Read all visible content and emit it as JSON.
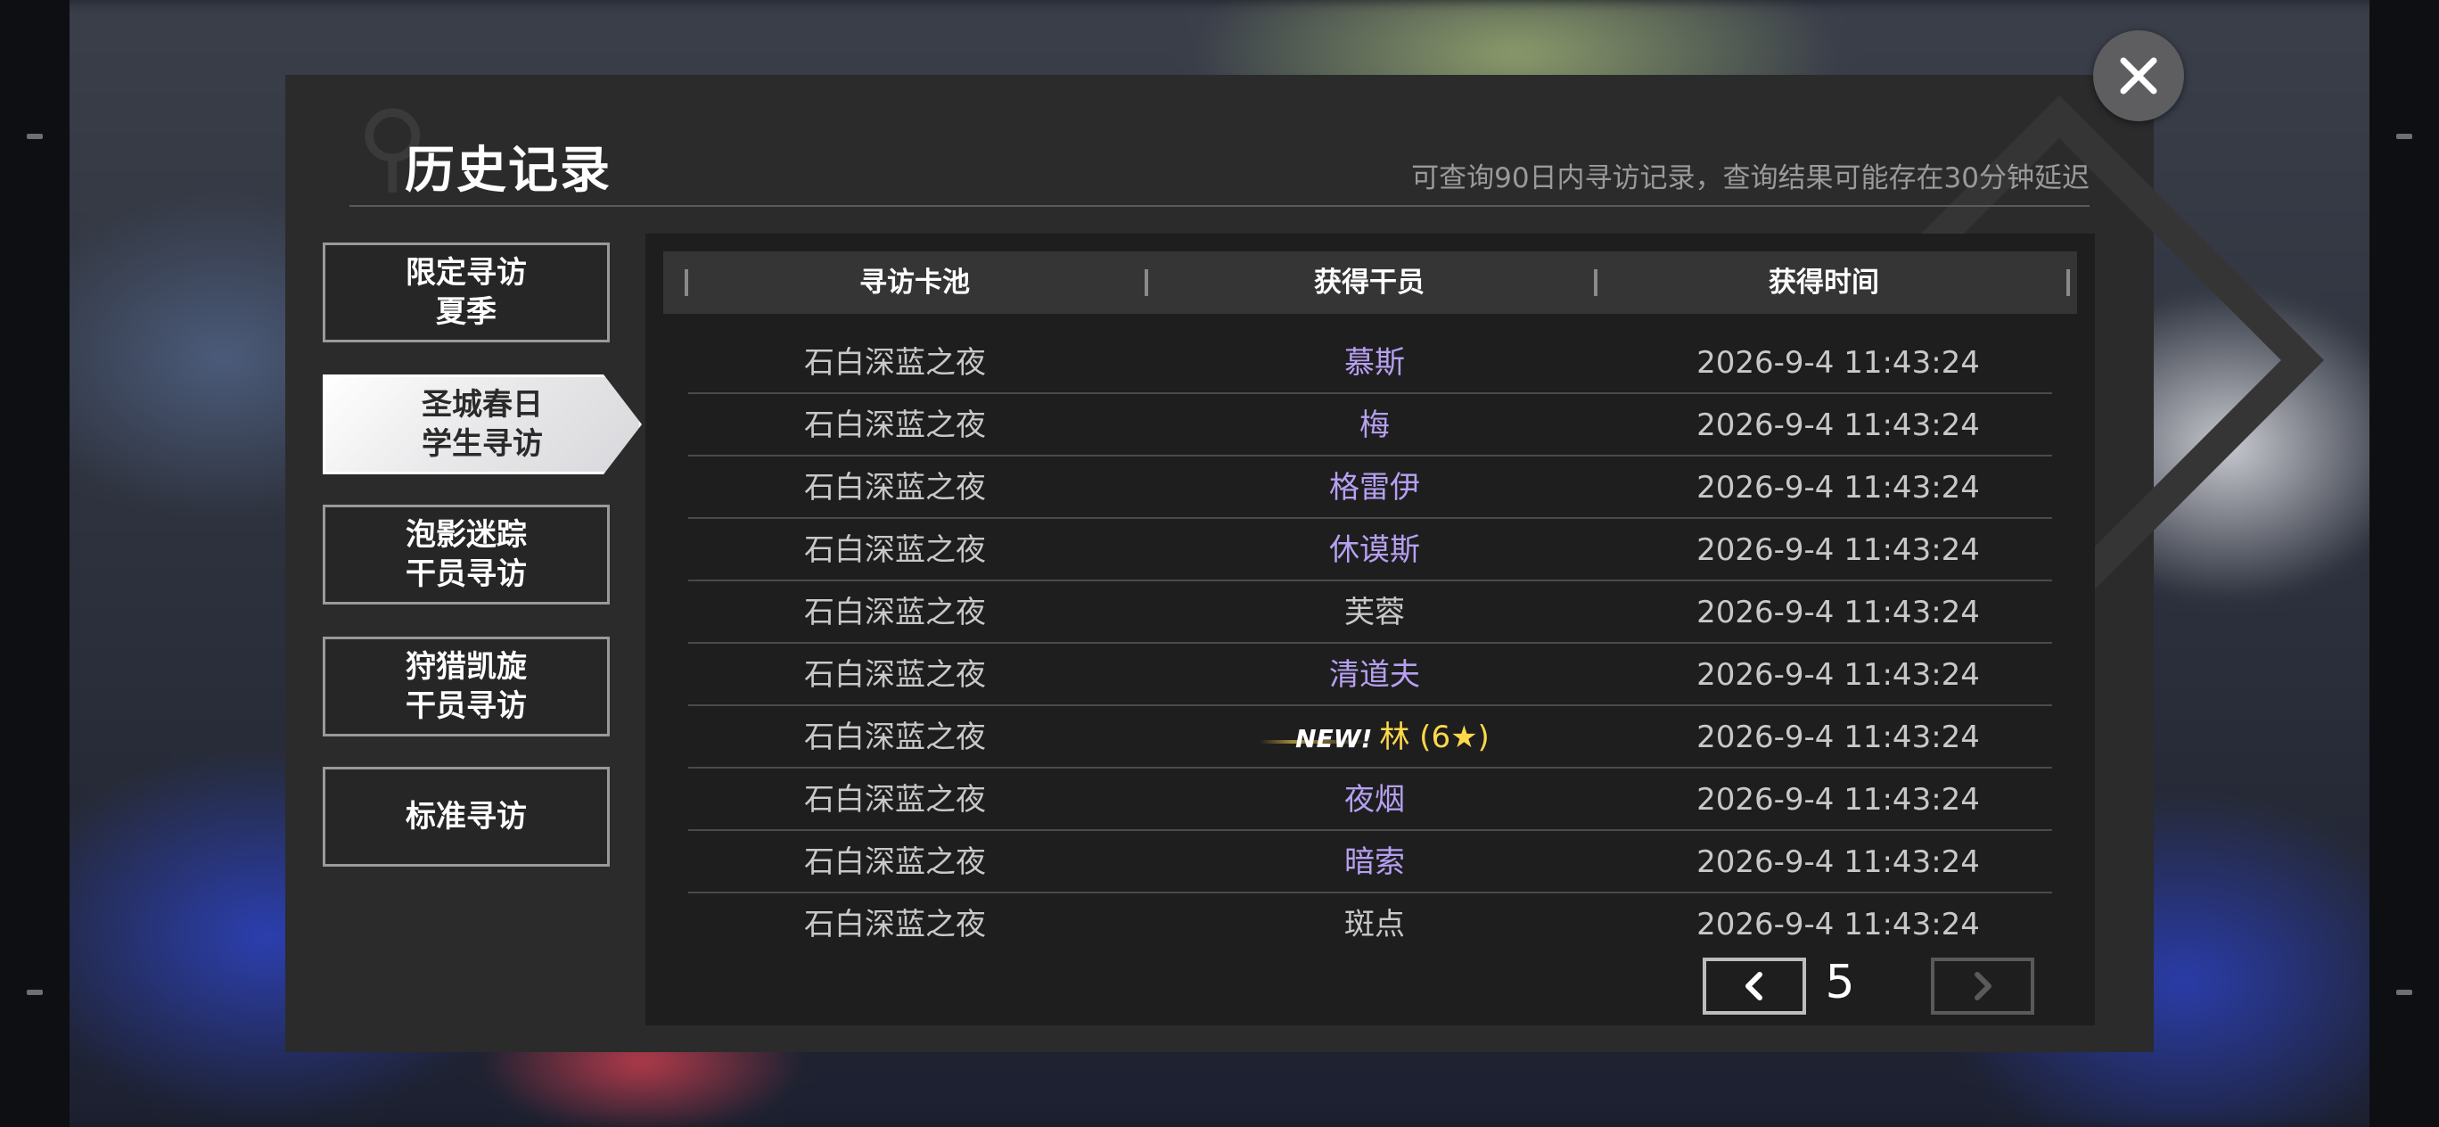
{
  "dialog": {
    "title": "历史记录",
    "hint": "可查询90日内寻访记录，查询结果可能存在30分钟延迟"
  },
  "tabs": [
    {
      "label": "限定寻访\n夏季",
      "active": false
    },
    {
      "label": "圣城春日\n学生寻访",
      "active": true
    },
    {
      "label": "泡影迷踪\n干员寻访",
      "active": false
    },
    {
      "label": "狩猎凯旋\n干员寻访",
      "active": false
    },
    {
      "label": "标准寻访",
      "active": false
    }
  ],
  "table": {
    "headers": [
      "寻访卡池",
      "获得干员",
      "获得时间"
    ],
    "rows": [
      {
        "pool": "石白深蓝之夜",
        "operator": "慕斯",
        "time": "2026-9-4 11:43:24",
        "color": "#b6a0f0"
      },
      {
        "pool": "石白深蓝之夜",
        "operator": "梅",
        "time": "2026-9-4 11:43:24",
        "color": "#b6a0f0"
      },
      {
        "pool": "石白深蓝之夜",
        "operator": "格雷伊",
        "time": "2026-9-4 11:43:24",
        "color": "#b6a0f0"
      },
      {
        "pool": "石白深蓝之夜",
        "operator": "休谟斯",
        "time": "2026-9-4 11:43:24",
        "color": "#b6a0f0"
      },
      {
        "pool": "石白深蓝之夜",
        "operator": "芙蓉",
        "time": "2026-9-4 11:43:24",
        "color": "#c8c8c8"
      },
      {
        "pool": "石白深蓝之夜",
        "operator": "清道夫",
        "time": "2026-9-4 11:43:24",
        "color": "#b6a0f0"
      },
      {
        "pool": "石白深蓝之夜",
        "operator": "林 (6★)",
        "time": "2026-9-4 11:43:24",
        "color": "#ffd94a",
        "new_badge": "NEW!"
      },
      {
        "pool": "石白深蓝之夜",
        "operator": "夜烟",
        "time": "2026-9-4 11:43:24",
        "color": "#b6a0f0"
      },
      {
        "pool": "石白深蓝之夜",
        "operator": "暗索",
        "time": "2026-9-4 11:43:24",
        "color": "#b6a0f0"
      },
      {
        "pool": "石白深蓝之夜",
        "operator": "斑点",
        "time": "2026-9-4 11:43:24",
        "color": "#c8c8c8"
      }
    ]
  },
  "pagination": {
    "current_page": "5",
    "prev_enabled": true,
    "next_enabled": false
  },
  "icons": {
    "close": "close-icon",
    "prev": "chevron-left-icon",
    "next": "chevron-right-icon"
  }
}
